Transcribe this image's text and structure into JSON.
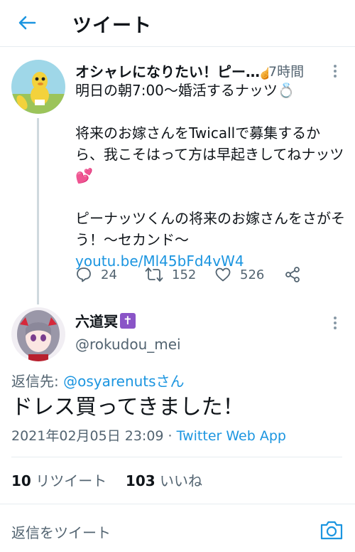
{
  "header": {
    "title": "ツイート"
  },
  "tweet1": {
    "display_name": "オシャレになりたい！ピーナッツくん",
    "time": "7時間",
    "body_line1": "明日の朝7:00〜婚活するナッツ💍",
    "body_line2": "将来のお嫁さんをTwicallで募集するから、我こそはって方は早起きしてねナッツ💕",
    "body_line3": "ピーナッツくんの将来のお嫁さんをさがそう！〜セカンド〜 ",
    "link_text": "youtu.be/Ml45bFd4vW4",
    "replies": "24",
    "retweets": "152",
    "likes": "526"
  },
  "tweet2": {
    "display_name": "六道冥",
    "handle": "@rokudou_mei",
    "reply_to_label": "返信先: ",
    "reply_to_handle": "@osyarenutsさん",
    "text": "ドレス買ってきました！",
    "date": "2021年02月05日 23:09",
    "separator": " · ",
    "source": "Twitter Web App",
    "retweet_count": "10",
    "retweet_label": "リツイート",
    "like_count": "103",
    "like_label": "いいね"
  },
  "reply_bar": {
    "placeholder": "返信をツイート"
  },
  "colors": {
    "accent": "#1b95e0",
    "muted": "#536471",
    "divider": "#e6ecf0"
  }
}
